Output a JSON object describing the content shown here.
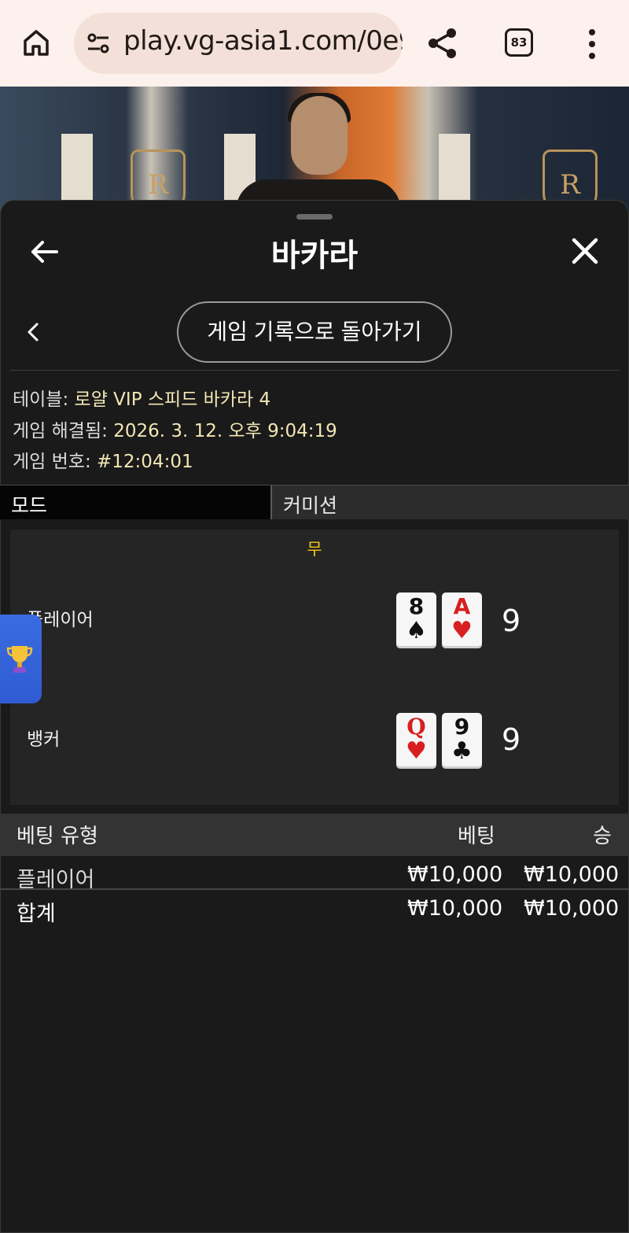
{
  "browser": {
    "url": "play.vg-asia1.com/0e9",
    "tab_count": "83",
    "icons": [
      "home-icon",
      "site-settings-icon",
      "share-icon",
      "tab-switcher-icon",
      "more-vert-icon"
    ]
  },
  "panel": {
    "title": "바카라",
    "back_to_history": "게임 기록으로 돌아가기"
  },
  "info": {
    "table_label": "테이블:",
    "table_value": "로얄 VIP 스피드 바카라 4",
    "resolved_label": "게임 해결됨:",
    "resolved_value": "2026. 3. 12. 오후 9:04:19",
    "game_no_label": "게임 번호:",
    "game_no_value": "#12:04:01"
  },
  "mode": {
    "label": "모드",
    "value": "커미션"
  },
  "result": {
    "outcome": "무",
    "player": {
      "label": "플레이어",
      "cards": [
        {
          "rank": "8",
          "suit": "♠",
          "color": "black"
        },
        {
          "rank": "A",
          "suit": "♥",
          "color": "red"
        }
      ],
      "score": "9"
    },
    "banker": {
      "label": "뱅커",
      "cards": [
        {
          "rank": "Q",
          "suit": "♥",
          "color": "red"
        },
        {
          "rank": "9",
          "suit": "♣",
          "color": "black"
        }
      ],
      "score": "9"
    }
  },
  "bets": {
    "headers": {
      "type": "베팅 유형",
      "bet": "베팅",
      "win": "승"
    },
    "rows": [
      {
        "type": "플레이어",
        "bet": "₩10,000",
        "win": "₩10,000"
      }
    ],
    "total": {
      "type": "합계",
      "bet": "₩10,000",
      "win": "₩10,000"
    }
  },
  "colors": {
    "outcome": "#f0c419",
    "info_value": "#f2e6b5",
    "trophy_widget": "#3a6be0"
  }
}
